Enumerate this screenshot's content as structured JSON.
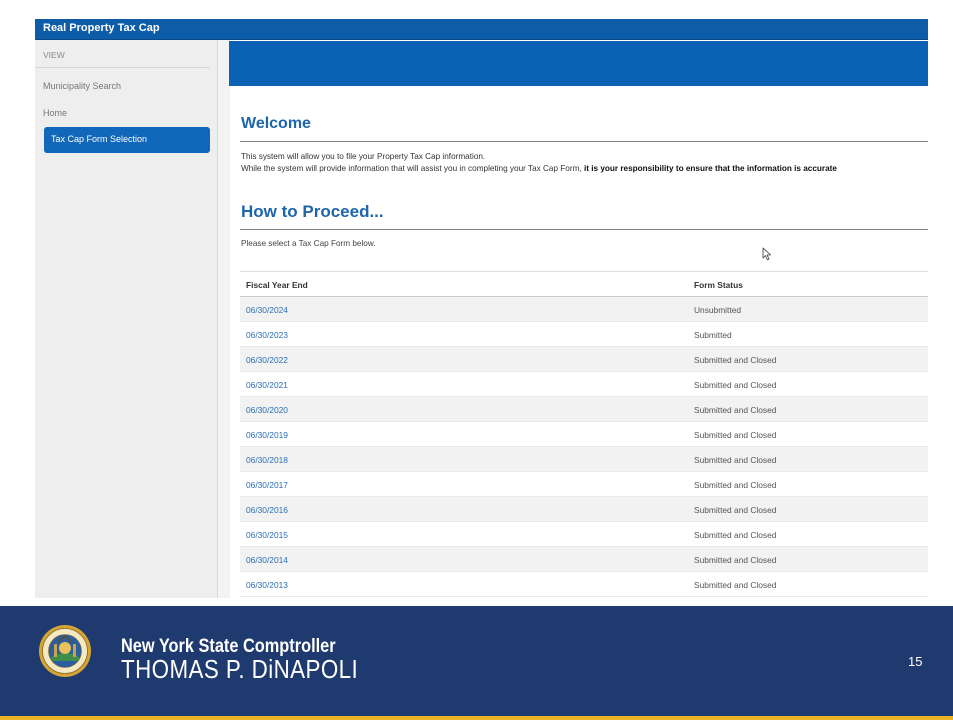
{
  "app": {
    "title": "Real Property Tax Cap"
  },
  "sidebar": {
    "heading": "VIEW",
    "items": [
      {
        "label": "Municipality Search"
      },
      {
        "label": "Home"
      },
      {
        "label": "Tax Cap Form Selection",
        "active": true
      }
    ]
  },
  "welcome": {
    "title": "Welcome",
    "line1": "This system will allow you to file your Property Tax Cap information.",
    "line2_prefix": "While the system will provide information that will assist you in completing your Tax Cap Form, ",
    "line2_bold": "it is your responsibility to ensure that the information is accurate"
  },
  "proceed": {
    "title": "How to Proceed...",
    "instruction": "Please select a Tax Cap Form below."
  },
  "table": {
    "headers": {
      "fiscal_year_end": "Fiscal Year End",
      "form_status": "Form Status"
    },
    "rows": [
      {
        "fiscal_year_end": "06/30/2024",
        "form_status": "Unsubmitted"
      },
      {
        "fiscal_year_end": "06/30/2023",
        "form_status": "Submitted"
      },
      {
        "fiscal_year_end": "06/30/2022",
        "form_status": "Submitted and Closed"
      },
      {
        "fiscal_year_end": "06/30/2021",
        "form_status": "Submitted and Closed"
      },
      {
        "fiscal_year_end": "06/30/2020",
        "form_status": "Submitted and Closed"
      },
      {
        "fiscal_year_end": "06/30/2019",
        "form_status": "Submitted and Closed"
      },
      {
        "fiscal_year_end": "06/30/2018",
        "form_status": "Submitted and Closed"
      },
      {
        "fiscal_year_end": "06/30/2017",
        "form_status": "Submitted and Closed"
      },
      {
        "fiscal_year_end": "06/30/2016",
        "form_status": "Submitted and Closed"
      },
      {
        "fiscal_year_end": "06/30/2015",
        "form_status": "Submitted and Closed"
      },
      {
        "fiscal_year_end": "06/30/2014",
        "form_status": "Submitted and Closed"
      },
      {
        "fiscal_year_end": "06/30/2013",
        "form_status": "Submitted and Closed"
      }
    ]
  },
  "footer": {
    "line1": "New York State Comptroller",
    "line2": "THOMAS P. DiNAPOLI",
    "slide_number": "15",
    "seal_icon": "nys-seal-icon"
  },
  "colors": {
    "brand_blue": "#0b62b4",
    "link_blue": "#2a6eb5",
    "footer_navy": "#1f3a6e",
    "footer_gold": "#e8b324"
  }
}
